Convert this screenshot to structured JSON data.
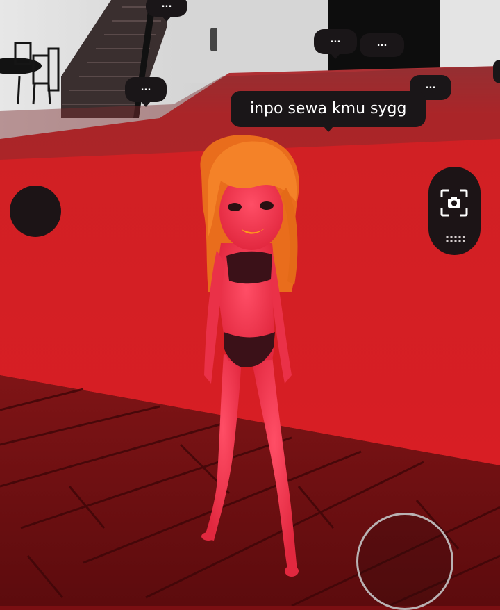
{
  "chat": {
    "main_message": "inpo sewa kmu sygg",
    "typing_indicators": [
      "...",
      "...",
      "...",
      "...",
      "..."
    ]
  },
  "hud": {
    "left_button_icon": "circle-button",
    "camera_icon": "camera-capture-icon",
    "camera_menu_icon": "dots-grid-icon",
    "joystick_icon": "joystick-ring"
  },
  "colors": {
    "floor_red": "#d01c22",
    "wood_floor": "#8a1517",
    "hair": "#f07a22",
    "skin": "#ee3a52",
    "hud_dark": "#1c1416",
    "wall_gray": "#dcdcdc"
  }
}
